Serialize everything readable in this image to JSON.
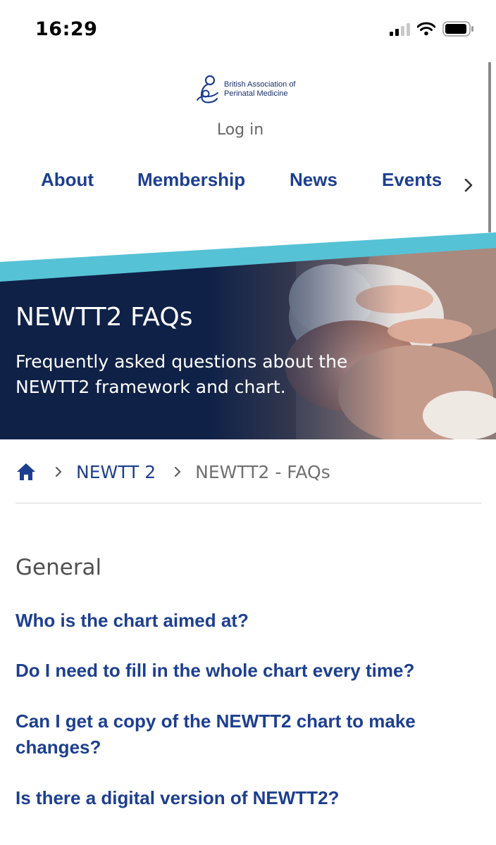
{
  "status_bar": {
    "time": "16:29"
  },
  "header": {
    "logo_line1": "British Association of",
    "logo_line2": "Perinatal Medicine",
    "login_label": "Log in"
  },
  "nav": {
    "items": [
      "About",
      "Membership",
      "News",
      "Events"
    ]
  },
  "hero": {
    "title": "NEWTT2 FAQs",
    "subtitle": "Frequently asked questions about the NEWTT2 framework and chart."
  },
  "breadcrumb": {
    "items": [
      "NEWTT 2",
      "NEWTT2 - FAQs"
    ]
  },
  "content": {
    "section_title": "General",
    "faqs": [
      "Who is the chart aimed at?",
      "Do I need to fill in the whole chart every time?",
      "Can I get a copy of the NEWTT2 chart to make changes?",
      "Is there a digital version of NEWTT2?"
    ]
  },
  "colors": {
    "brand_blue": "#1d3f8f",
    "hero_navy": "#0f2147",
    "accent_teal": "#56c2d6"
  },
  "icons": [
    "signal-icon",
    "wifi-icon",
    "battery-icon",
    "logo-icon",
    "chevron-right-icon",
    "home-icon"
  ]
}
